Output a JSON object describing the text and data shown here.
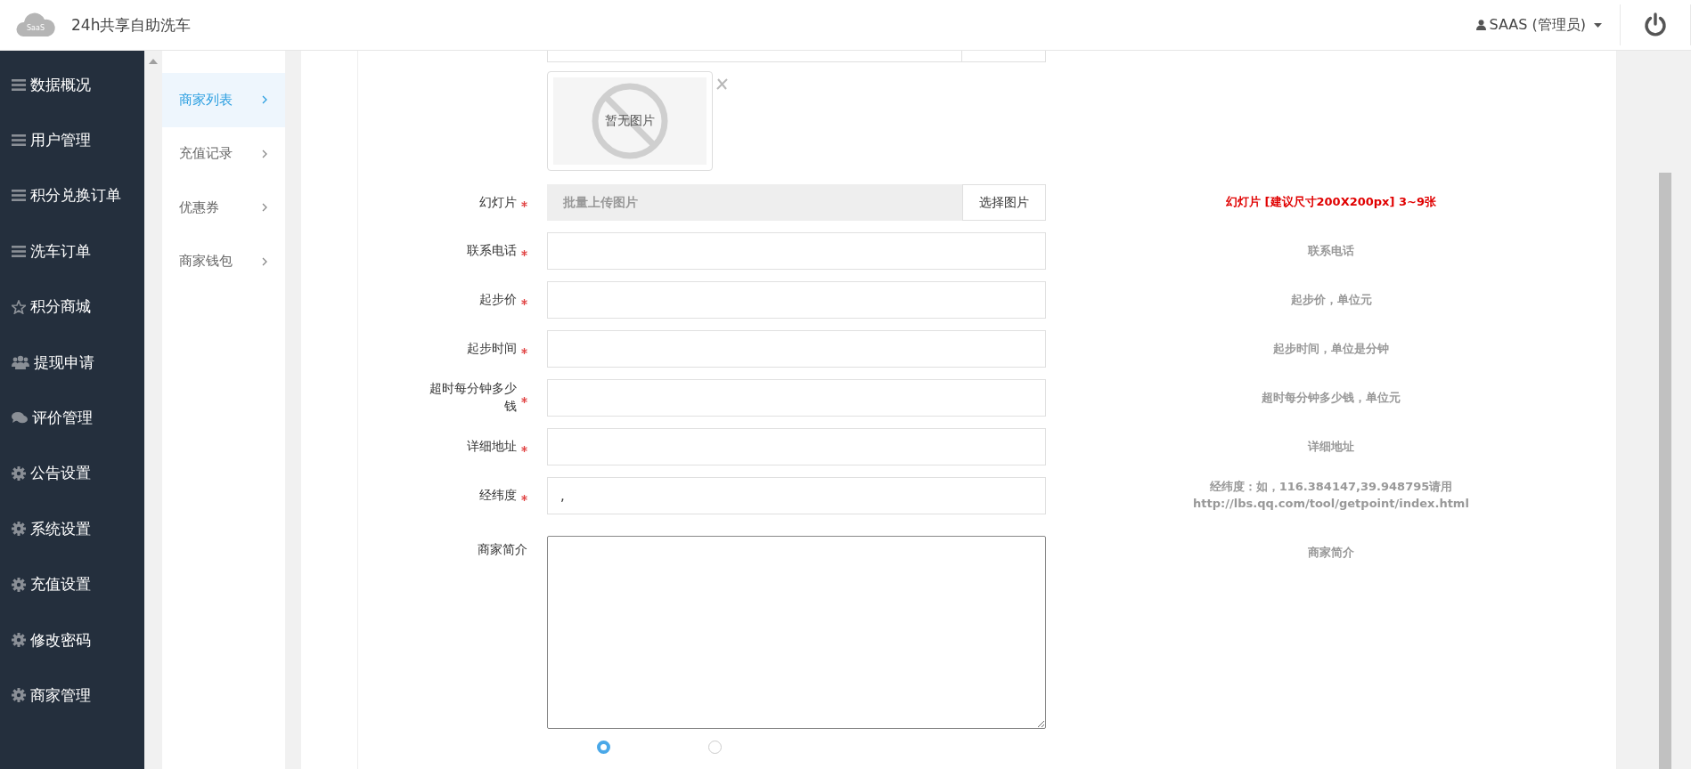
{
  "header": {
    "logo_text": "SaaS",
    "title": "24h共享自助洗车",
    "user": "SAAS (管理员)"
  },
  "sidebar": {
    "items": [
      {
        "label": "数据概况",
        "kind": "list"
      },
      {
        "label": "用户管理",
        "kind": "list"
      },
      {
        "label": "积分兑换订单",
        "kind": "list"
      },
      {
        "label": "洗车订单",
        "kind": "list"
      },
      {
        "label": "积分商城",
        "kind": "star"
      },
      {
        "label": "提现申请",
        "kind": "users"
      },
      {
        "label": "评价管理",
        "kind": "comments"
      },
      {
        "label": "公告设置",
        "kind": "gear"
      },
      {
        "label": "系统设置",
        "kind": "gear"
      },
      {
        "label": "充值设置",
        "kind": "gear"
      },
      {
        "label": "修改密码",
        "kind": "gear"
      },
      {
        "label": "商家管理",
        "kind": "gear"
      }
    ]
  },
  "submenu": [
    {
      "label": "商家列表",
      "selected": true
    },
    {
      "label": "充值记录",
      "selected": false
    },
    {
      "label": "优惠券",
      "selected": false
    },
    {
      "label": "商家钱包",
      "selected": false
    }
  ],
  "form": {
    "image_preview": {
      "text": "暂无图片"
    },
    "fields": [
      {
        "kind": "upload",
        "label": "幻灯片",
        "required": true,
        "placeholder": "批量上传图片",
        "button": "选择图片",
        "hint": "幻灯片 [建议尺寸200X200px] 3~9张",
        "hint_emphasis": true
      },
      {
        "kind": "text",
        "label": "联系电话",
        "required": true,
        "hint": "联系电话",
        "hint_emphasis": false
      },
      {
        "kind": "text",
        "label": "起步价",
        "required": true,
        "hint": "起步价，单位元",
        "hint_emphasis": false
      },
      {
        "kind": "text",
        "label": "起步时间",
        "required": true,
        "hint": "起步时间，单位是分钟",
        "hint_emphasis": false
      },
      {
        "kind": "text",
        "label": "超时每分钟多少钱",
        "required": true,
        "hint": "超时每分钟多少钱，单位元",
        "hint_emphasis": false
      },
      {
        "kind": "text",
        "label": "详细地址",
        "required": true,
        "hint": "详细地址",
        "hint_emphasis": false
      },
      {
        "kind": "text",
        "label": "经纬度",
        "required": true,
        "value": ",",
        "hint": "经纬度：如，116.384147,39.948795请用http://lbs.qq.com/tool/getpoint/index.html",
        "hint_emphasis": false
      },
      {
        "kind": "textarea",
        "label": "商家简介",
        "required": false,
        "hint": "商家简介",
        "hint_emphasis": false
      }
    ],
    "radio_options": [
      {
        "selected": true
      },
      {
        "selected": false
      }
    ]
  }
}
